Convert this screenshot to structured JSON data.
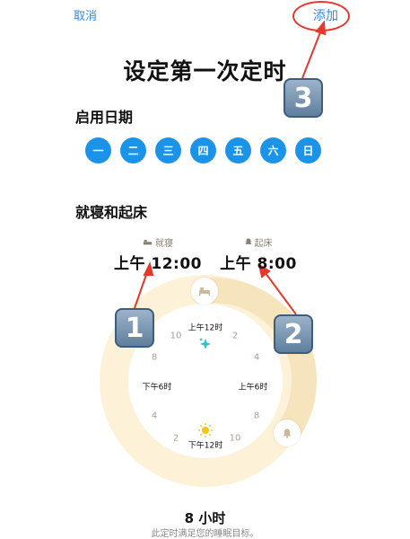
{
  "nav": {
    "cancel_label": "取消",
    "add_label": "添加"
  },
  "title": "设定第一次定时",
  "days_section": {
    "heading": "启用日期",
    "days": [
      "一",
      "二",
      "三",
      "四",
      "五",
      "六",
      "日"
    ],
    "selected_color": "#1a93e8"
  },
  "sleep_section": {
    "heading": "就寝和起床",
    "bedtime": {
      "label": "就寝",
      "icon": "bed-icon",
      "value": "上午 12:00"
    },
    "wake": {
      "label": "起床",
      "icon": "bell-icon",
      "value": "上午 8:00"
    }
  },
  "clock": {
    "numbers": [
      "10",
      "2",
      "8",
      "4",
      "4",
      "8",
      "2",
      "10"
    ],
    "labels": [
      "上午12时",
      "下午6时",
      "上午6时",
      "下午12时"
    ],
    "ring_color": "#fdf1d7",
    "arc_color": "#f6e4bd"
  },
  "annotations": {
    "badges": [
      "1",
      "2",
      "3"
    ],
    "color": "#e43a2e"
  },
  "duration": {
    "value": "8 小时",
    "note": "此定时满足您的睡眠目标。"
  }
}
